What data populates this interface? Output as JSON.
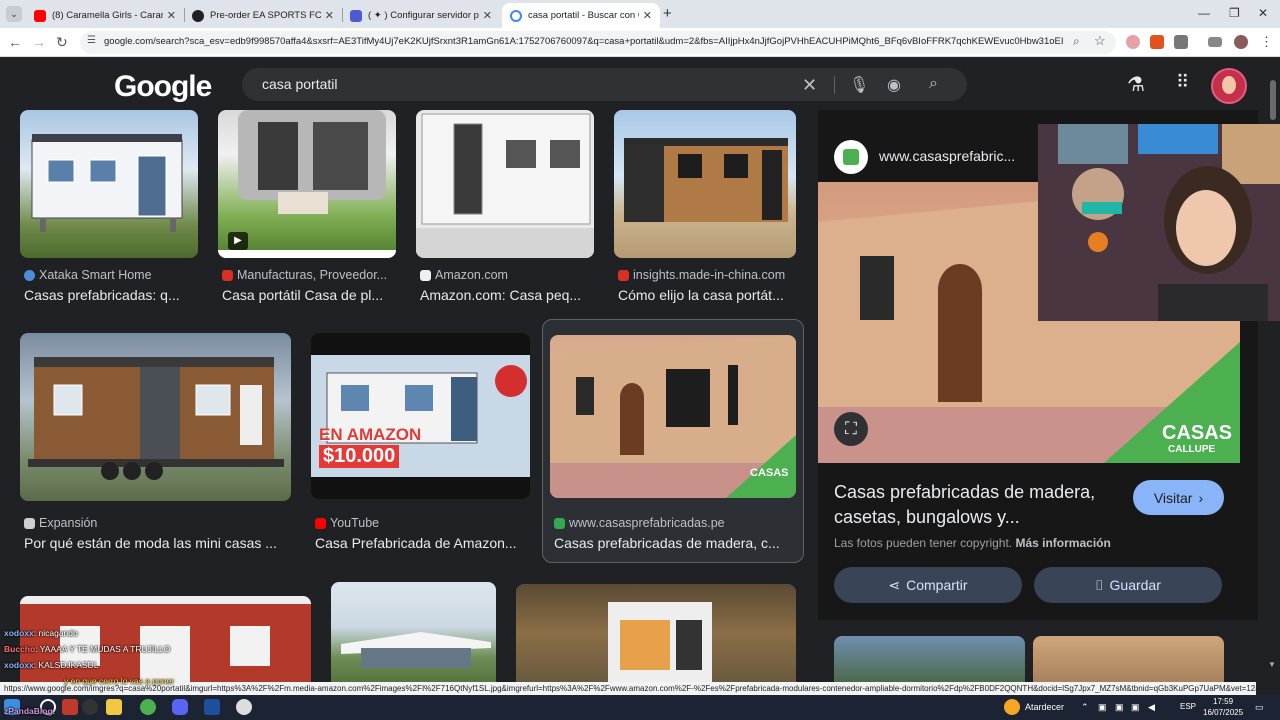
{
  "browser": {
    "tabs": [
      {
        "title": "(8) Caramella Girls - Caramello",
        "color": "#ff0000"
      },
      {
        "title": "Pre-order EA SPORTS FC™ 26 -",
        "color": "#202124"
      },
      {
        "title": "( ✦ ) Configurar servidor privad",
        "color": "#4c5bd4"
      },
      {
        "title": "casa portatil - Buscar con Goog",
        "color": "#4285f4"
      }
    ],
    "url": "google.com/search?sca_esv=edb9f998570affa4&sxsrf=AE3TifMy4Uj7eK2KUjfSrxnt3R1amGn61A:1752706760097&q=casa+portatil&udm=2&fbs=AIIjpHx4nJjfGojPVHhEACUHPiMQht6_BFq6vBIoFFRK7qchKEWEvuc0Hbw31oEI7c8o3y5..."
  },
  "google": {
    "logo": "Google",
    "query": "casa portatil"
  },
  "results": [
    {
      "source": "Xataka Smart Home",
      "title": "Casas prefabricadas: q...",
      "favColor": "#4a90d9"
    },
    {
      "source": "Manufacturas, Proveedor...",
      "title": "Casa portátil Casa de pl...",
      "favColor": "#d93025"
    },
    {
      "source": "Amazon.com",
      "title": "Amazon.com: Casa peq...",
      "favColor": "#f0f0f0"
    },
    {
      "source": "insights.made-in-china.com",
      "title": "Cómo elijo la casa portát...",
      "favColor": "#d93025"
    },
    {
      "source": "Expansión",
      "title": "Por qué están de moda las mini casas ...",
      "favColor": "#cfcfcf"
    },
    {
      "source": "YouTube",
      "title": "Casa Prefabricada de Amazon...",
      "favColor": "#ff0000"
    },
    {
      "source": "www.casasprefabricadas.pe",
      "title": "Casas prefabricadas de madera, c...",
      "favColor": "#34a853"
    }
  ],
  "thumb_overlay": {
    "amazon": "EN AMAZON",
    "price": "$10.000",
    "casas": "CASAS",
    "callupe": "CALLUPE"
  },
  "side_panel": {
    "site": "www.casasprefabric...",
    "title": "Casas prefabricadas de madera, casetas, bungalows y...",
    "visit": "Visitar",
    "copyright": "Las fotos pueden tener copyright.",
    "more_info": "Más información",
    "share": "Compartir",
    "save": "Guardar"
  },
  "chat": [
    {
      "user": "xodoxx",
      "sep": ": ",
      "msg": "nicagando",
      "color": "#8ab4f8"
    },
    {
      "user": "Buccho",
      "sep": ": ",
      "msg": "YAAAA Y TE MUDAS A TRUJILLO",
      "color": "#ff6b6b"
    },
    {
      "user": "xodoxx",
      "sep": ": ",
      "msg": "KALSDJKASDL",
      "color": "#8ab4f8"
    },
    {
      "user": "",
      "sep": "",
      "msg": "y en que cerro lo vas a poner",
      "color": "#ffd54f"
    },
    {
      "user": "zPandaBlog",
      "sep": ": ",
      "msg": "",
      "color": "#ce93d8"
    }
  ],
  "status_bar": "https://www.google.com/imgres?q=casa%20portatil&imgurl=https%3A%2F%2Fm.media-amazon.com%2Fimages%2FI%2F716QtNyf1SL.jpg&imgrefurl=https%3A%2F%2Fwww.amazon.com%2F-%2Fes%2Fprefabricada-modulares-contenedor-ampliable-dormitorio%2Fdp%2FB0DF2QQNTH&docid=lSg7Jpx7_MZ7sM&tbnid=qGb3KuPGp7UaPM&vet=12ahUK...",
  "taskbar": {
    "weather": "Atardecer",
    "lang": "ESP",
    "time": "17:59",
    "date": "16/07/2025"
  }
}
